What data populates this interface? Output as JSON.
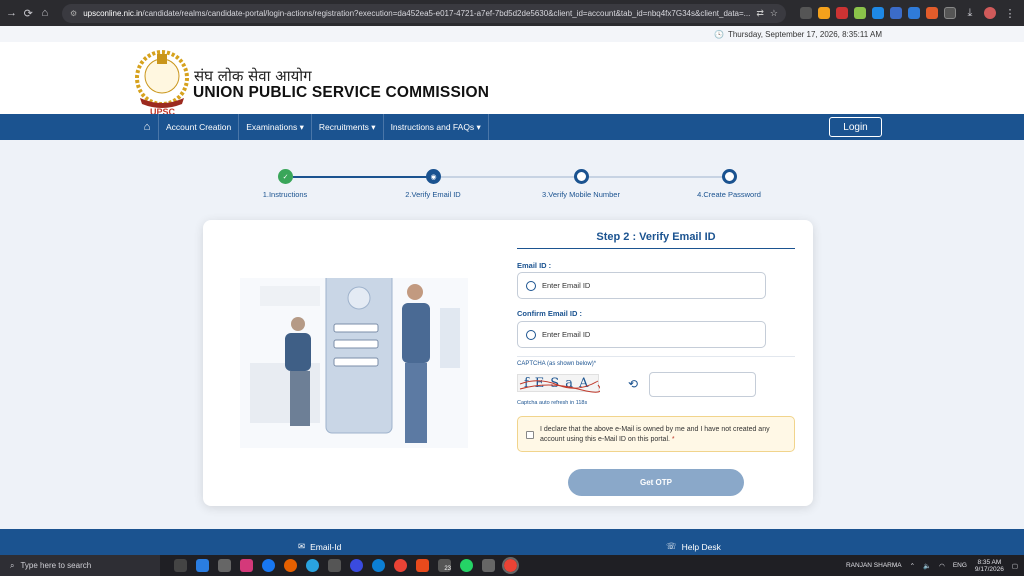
{
  "browser": {
    "url_host": "upsconline.nic.in",
    "url_path": "/candidate/realms/candidate-portal/login-actions/registration?execution=da452ea5-e017-4721-a7ef-7bd5d2de5630&client_id=account&tab_id=nbq4fx7G34s&client_data=..."
  },
  "datebar": {
    "datetime": "Thursday, September 17, 2026, 8:35:11 AM"
  },
  "header": {
    "emblem_text": "UPSC",
    "hindi_title": "संघ लोक सेवा आयोग",
    "english_title": "UNION PUBLIC SERVICE COMMISSION"
  },
  "nav": {
    "items": [
      {
        "label": "Account Creation"
      },
      {
        "label": "Examinations ▾"
      },
      {
        "label": "Recruitments ▾"
      },
      {
        "label": "Instructions and FAQs ▾"
      }
    ],
    "login_label": "Login"
  },
  "stepper": {
    "steps": [
      {
        "label": "1.Instructions",
        "state": "done"
      },
      {
        "label": "2.Verify Email ID",
        "state": "active"
      },
      {
        "label": "3.Verify Mobile Number",
        "state": "pending"
      },
      {
        "label": "4.Create Password",
        "state": "pending"
      }
    ]
  },
  "form": {
    "title": "Step 2 : Verify Email ID",
    "email_label": "Email ID :",
    "email_placeholder": "Enter Email ID",
    "confirm_label": "Confirm Email ID :",
    "confirm_placeholder": "Enter Email ID",
    "captcha_label": "CAPTCHA (as shown below)*",
    "captcha_text": "fESaA",
    "captcha_note": "Captcha auto refresh in 118s",
    "declaration": "I declare that the above e-Mail is owned by me and I have not created any account using this e-Mail ID on this portal.",
    "declaration_req": "*",
    "otp_button": "Get OTP"
  },
  "footer": {
    "email_label": "Email-Id",
    "help_label": "Help Desk"
  },
  "taskbar": {
    "search_placeholder": "Type here to search",
    "user": "RANJAN SHARMA",
    "lang": "ENG",
    "time": "8:35 AM",
    "date": "9/17/2026",
    "badge": "23"
  },
  "colors": {
    "primary": "#1b5390",
    "done_step": "#3aa65a",
    "otp_button": "#8aa8c9"
  }
}
